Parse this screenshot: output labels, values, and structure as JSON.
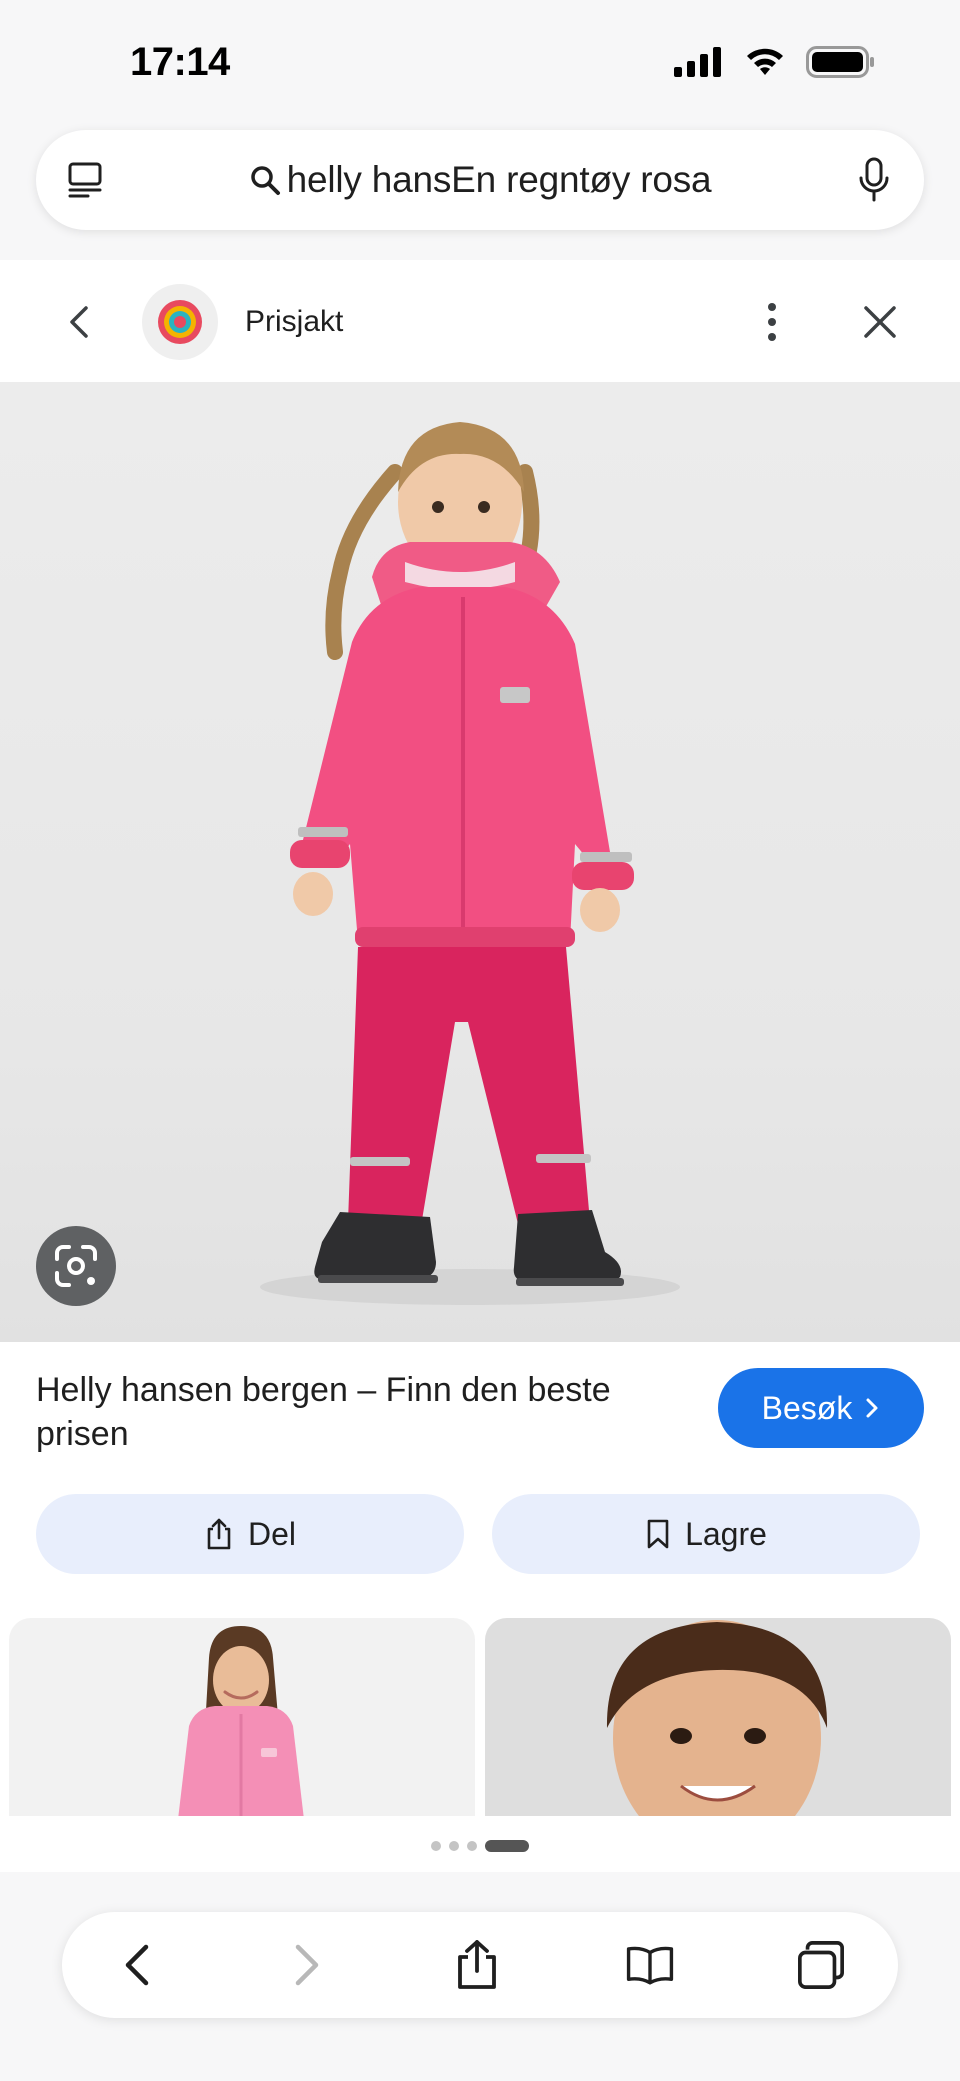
{
  "status_bar": {
    "time": "17:14",
    "icons": [
      "cellular-signal-icon",
      "wifi-icon",
      "battery-icon"
    ]
  },
  "search": {
    "query": "helly hansEn regntøy rosa",
    "icons": [
      "tabs-icon",
      "search-icon",
      "microphone-icon"
    ]
  },
  "source": {
    "name": "Prisjakt",
    "logo_colors": [
      "#e84a5f",
      "#f4b400",
      "#2ab3c0",
      "#e84a5f"
    ]
  },
  "result": {
    "title": "Helly hansen bergen – Finn den beste prisen",
    "visit_label": "Besøk",
    "accent": "#1a73e8"
  },
  "actions": {
    "share_label": "Del",
    "save_label": "Lagre"
  },
  "pager": {
    "pages": 4,
    "active": 4
  },
  "toolbar": {
    "icons": [
      "back-arrow-icon",
      "forward-arrow-icon",
      "share-icon",
      "bookmarks-icon",
      "tabs-overview-icon"
    ]
  }
}
